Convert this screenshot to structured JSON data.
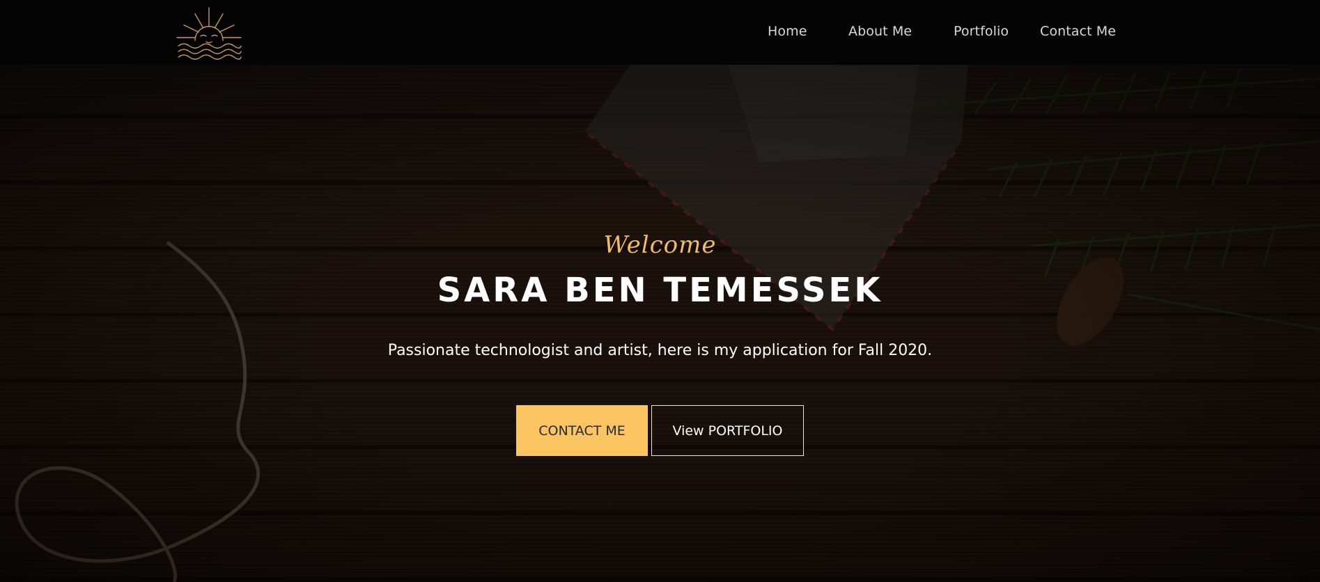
{
  "header": {
    "logo_icon": "sun-over-waves-logo",
    "nav": [
      {
        "label": "Home"
      },
      {
        "label": "About Me"
      },
      {
        "label": "Portfolio"
      },
      {
        "label": "Contact Me"
      }
    ]
  },
  "hero": {
    "welcome": "Welcome",
    "name": "SARA BEN TEMESSEK",
    "tagline": "Passionate technologist and artist, here is my application for Fall 2020.",
    "primary_button": "CONTACT ME",
    "secondary_button": "View PORTFOLIO"
  },
  "colors": {
    "accent": "#fbc561",
    "header_bg": "#040404",
    "nav_text": "#d9d9d9"
  }
}
